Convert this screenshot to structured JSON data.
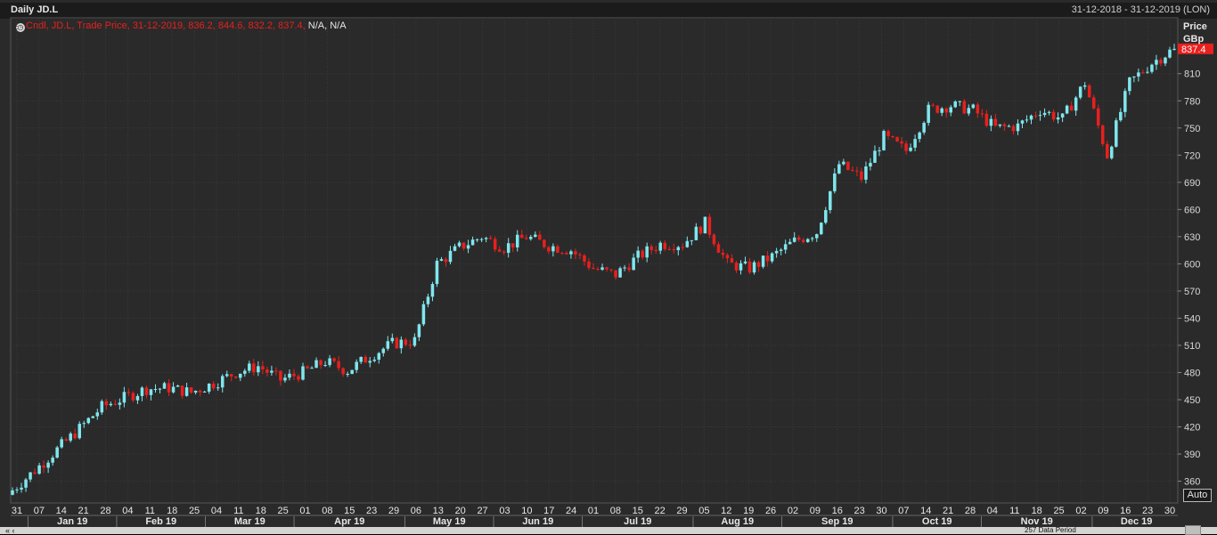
{
  "header": {
    "title": "Daily JD.L",
    "date_range": "31-12-2018 - 31-12-2019 (LON)"
  },
  "legend": {
    "icon": "clock-icon",
    "series_text": "Cndl, JD.L, Trade Price, 31-12-2019, 836.2, 844.6, 832.2, 837.4,",
    "na_text": " N/A, N/A"
  },
  "axis": {
    "y_title_line1": "Price",
    "y_title_line2": "GBp",
    "last_price_label": "837.4",
    "auto_label": "Auto"
  },
  "scroll": {
    "left_arrows": "« ‹",
    "info": "257 Data Period"
  },
  "colors": {
    "background": "#2a2a2a",
    "grid": "#3a3a3a",
    "up_candle": "#7fe7ee",
    "down_candle": "#e8201e",
    "last_price_bg": "#e8201e"
  },
  "chart_data": {
    "type": "candlestick",
    "y_ticks": [
      360,
      390,
      420,
      450,
      480,
      510,
      540,
      570,
      600,
      630,
      660,
      690,
      720,
      750,
      780,
      810
    ],
    "y_range": [
      336,
      852
    ],
    "day_ticks": [
      "31",
      "07",
      "14",
      "21",
      "28",
      "04",
      "11",
      "18",
      "25",
      "04",
      "11",
      "18",
      "25",
      "01",
      "08",
      "15",
      "23",
      "29",
      "06",
      "13",
      "20",
      "27",
      "03",
      "10",
      "17",
      "24",
      "01",
      "08",
      "15",
      "22",
      "29",
      "05",
      "12",
      "19",
      "26",
      "02",
      "09",
      "16",
      "23",
      "30",
      "07",
      "14",
      "21",
      "28",
      "04",
      "11",
      "18",
      "25",
      "02",
      "09",
      "16",
      "23",
      "30"
    ],
    "month_labels": [
      "Jan 19",
      "Feb 19",
      "Mar 19",
      "Apr 19",
      "May 19",
      "Jun 19",
      "Jul 19",
      "Aug 19",
      "Sep 19",
      "Oct 19",
      "Nov 19",
      "Dec 19"
    ],
    "weekly_closes": [
      350,
      372,
      395,
      418,
      442,
      452,
      462,
      463,
      458,
      468,
      480,
      487,
      472,
      480,
      492,
      482,
      498,
      512,
      515,
      600,
      618,
      630,
      618,
      630,
      620,
      615,
      595,
      588,
      608,
      622,
      622,
      645,
      600,
      595,
      608,
      625,
      635,
      710,
      695,
      740,
      725,
      770,
      775,
      770,
      750,
      752,
      770,
      760,
      800,
      720,
      800,
      822,
      837.4
    ],
    "last_candle": {
      "open": 836.2,
      "high": 844.6,
      "low": 832.2,
      "close": 837.4
    }
  }
}
